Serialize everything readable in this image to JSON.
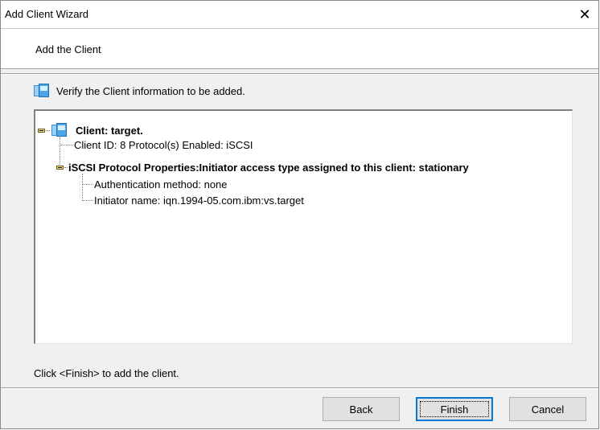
{
  "window": {
    "title": "Add Client Wizard",
    "close_glyph": "✕"
  },
  "header": {
    "step_title": "Add the Client"
  },
  "verify": {
    "icon": "client-icon",
    "text": "Verify the Client information to be added."
  },
  "tree": {
    "root_label": "Client: target.",
    "client_id": "Client ID: 8 Protocol(s) Enabled: iSCSI",
    "protocol_props": "iSCSI Protocol Properties:Initiator access type assigned to this client: stationary",
    "auth_method": "Authentication method: none",
    "initiator_name": "Initiator name: iqn.1994-05.com.ibm:vs.target"
  },
  "footer": {
    "hint": "Click <Finish> to add the client."
  },
  "buttons": {
    "back": "Back",
    "finish": "Finish",
    "cancel": "Cancel"
  },
  "colors": {
    "accent": "#0078d7",
    "dialog_bg": "#f0f0f0"
  }
}
